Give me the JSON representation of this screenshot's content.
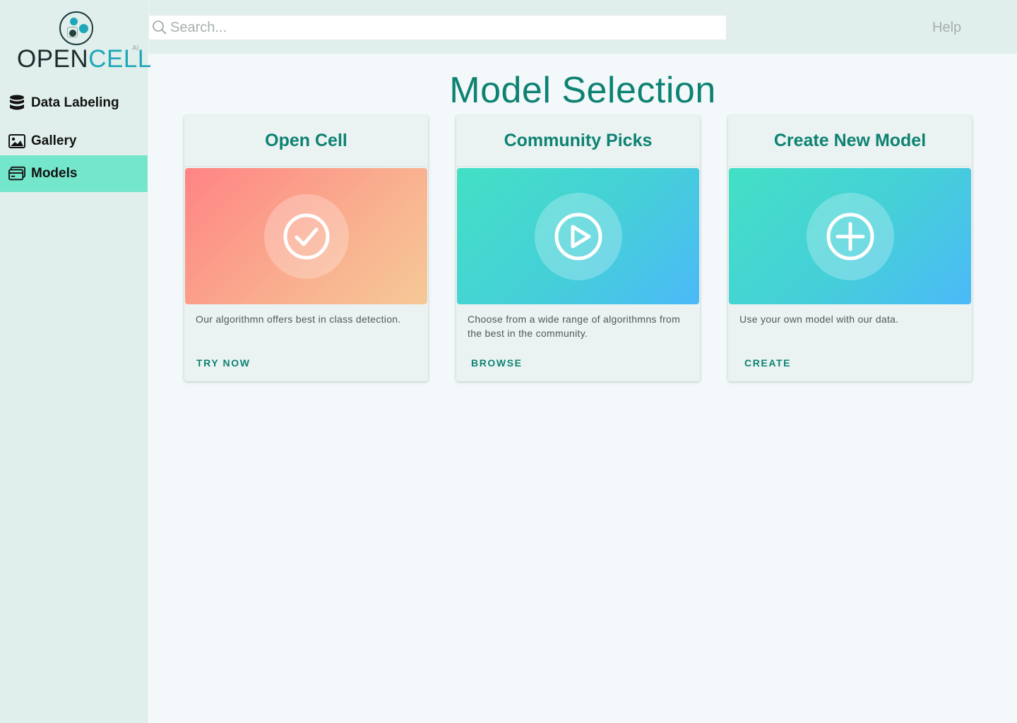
{
  "brand": {
    "name_part1": "OPEN",
    "name_part2": "CELL",
    "suffix": "AI",
    "accent_color": "#1ea7b8",
    "icon": "opencell-logo"
  },
  "sidebar": {
    "items": [
      {
        "label": "Data Labeling",
        "icon": "database-icon",
        "active": false
      },
      {
        "label": "Gallery",
        "icon": "image-icon",
        "active": false
      },
      {
        "label": "Models",
        "icon": "card-icon",
        "active": true
      }
    ],
    "active_color": "#74e6cb"
  },
  "header": {
    "search_placeholder": "Search...",
    "help_label": "Help"
  },
  "main": {
    "title": "Model Selection",
    "cards": [
      {
        "title": "Open Cell",
        "icon": "check-circle-icon",
        "description": "Our algorithmn offers best in class detection.",
        "action": "TRY NOW"
      },
      {
        "title": "Community Picks",
        "icon": "play-circle-icon",
        "description": "Choose from a wide range of algorithmns from the best in the community.",
        "action": "BROWSE"
      },
      {
        "title": "Create New Model",
        "icon": "plus-circle-icon",
        "description": "Use your own model with our data.",
        "action": "CREATE"
      }
    ],
    "title_color": "#0e8272"
  }
}
